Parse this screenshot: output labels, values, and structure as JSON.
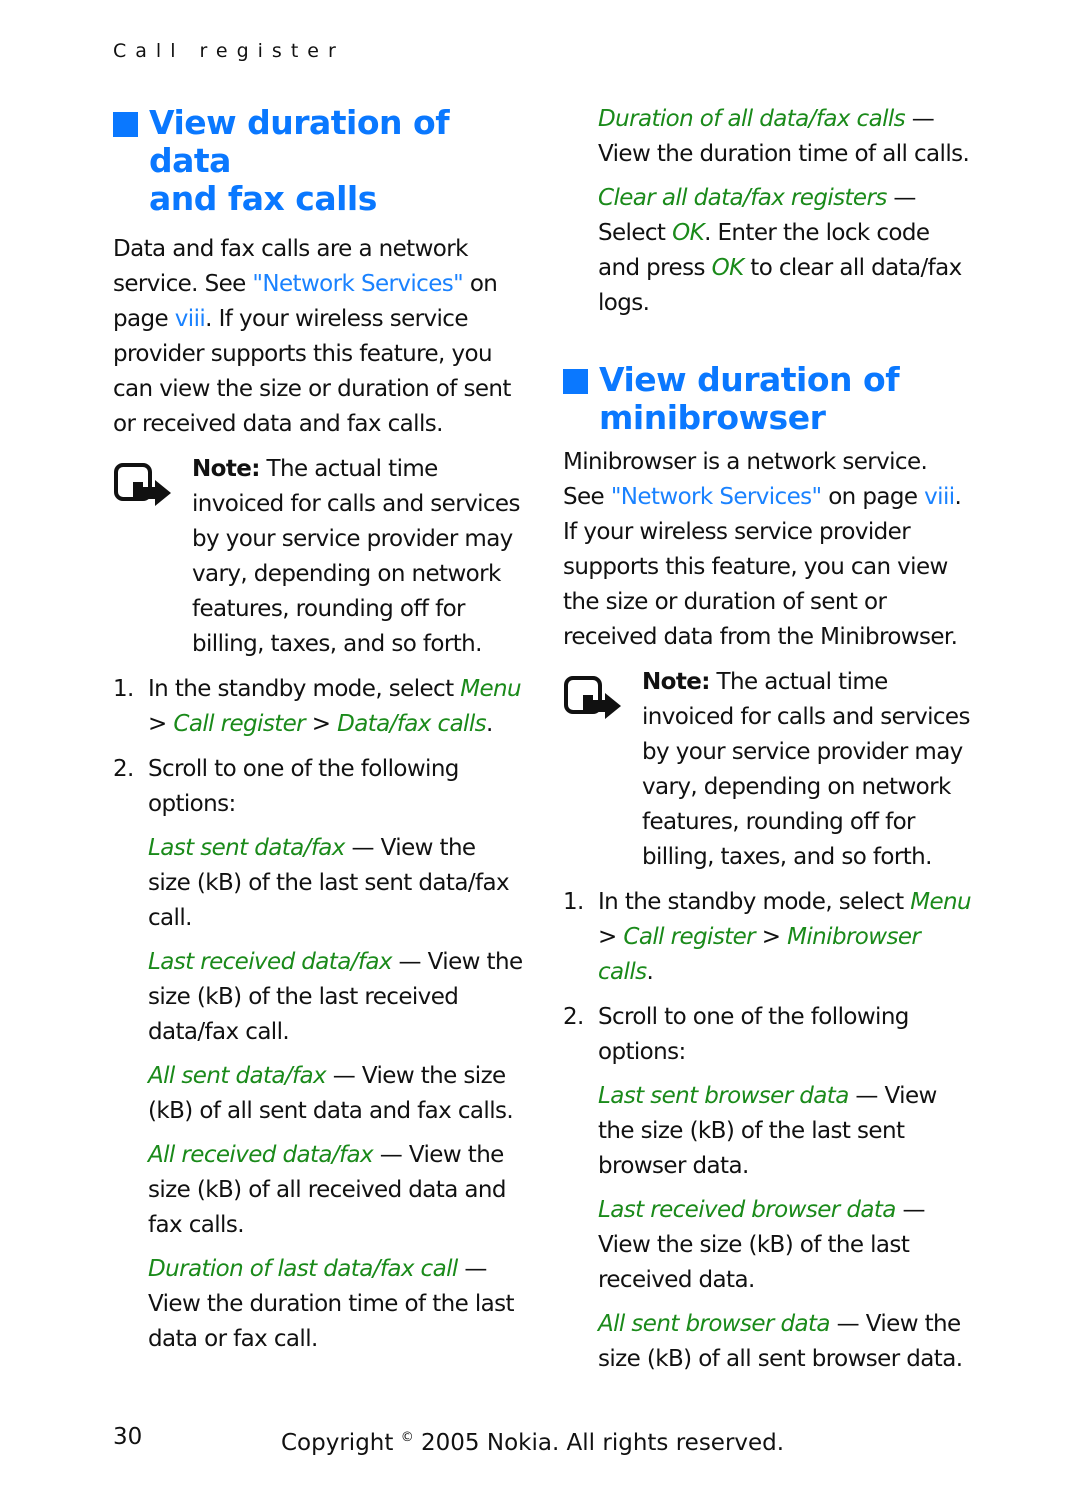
{
  "running_head": "Call register",
  "colors": {
    "heading_blue": "#0a78ff",
    "link_blue": "#1a82ff",
    "menu_green": "#1a8a1a",
    "text": "#111111"
  },
  "left": {
    "heading_line1": "View duration of data",
    "heading_line2": "and fax calls",
    "intro": {
      "pre": "Data and fax calls are a network service. See ",
      "link": "\"Network Services\"",
      "mid": " on page ",
      "page_link": "viii",
      "post": ". If your wireless service provider supports this feature, you can view the size or duration of sent or received data and fax calls."
    },
    "note": {
      "icon": "note-icon",
      "label": "Note:",
      "text": " The actual time invoiced for calls and services by your service provider may vary, depending on network features, rounding off for billing, taxes, and so forth."
    },
    "steps": [
      {
        "num": "1.",
        "text": "In the standby mode, select ",
        "path": [
          "Menu",
          "Call register",
          "Data/fax calls"
        ],
        "sep": " > ",
        "end": "."
      },
      {
        "num": "2.",
        "text": "Scroll to one of the following options:"
      }
    ],
    "options": [
      {
        "name": "Last sent data/fax",
        "desc": " — View the size (kB) of the last sent data/fax call."
      },
      {
        "name": "Last received data/fax",
        "desc": " — View the size (kB) of the last received data/fax call."
      },
      {
        "name": "All sent data/fax",
        "desc": " — View the size (kB) of all sent data and fax calls."
      },
      {
        "name": "All received data/fax",
        "desc": " — View the size (kB) of all received data and fax calls."
      },
      {
        "name": "Duration of last data/fax call",
        "desc": " — View the duration time of the last data or fax call."
      }
    ]
  },
  "right": {
    "options_cont": [
      {
        "name": "Duration of all data/fax calls",
        "desc": " — View the duration time of all calls."
      }
    ],
    "clear": {
      "name": "Clear all data/fax registers",
      "desc1": " — Select ",
      "ok1": "OK",
      "desc2": ". Enter the lock code and press ",
      "ok2": "OK",
      "desc3": " to clear all data/fax logs."
    },
    "heading_line1": "View duration of",
    "heading_line2": "minibrowser",
    "intro": {
      "pre": "Minibrowser is a network service. See ",
      "link": "\"Network Services\"",
      "mid": " on page ",
      "page_link": "viii",
      "post": ". If your wireless service provider supports this feature, you can view the size or duration of sent or received data from the Minibrowser."
    },
    "note": {
      "icon": "note-icon",
      "label": "Note:",
      "text": " The actual time invoiced for calls and services by your service provider may vary, depending on network features, rounding off for billing, taxes, and so forth."
    },
    "steps": [
      {
        "num": "1.",
        "text": "In the standby mode, select ",
        "path": [
          "Menu",
          "Call register",
          "Minibrowser calls"
        ],
        "sep": " > ",
        "end": "."
      },
      {
        "num": "2.",
        "text": "Scroll to one of the following options:"
      }
    ],
    "options": [
      {
        "name": "Last sent browser data",
        "desc": " — View the size (kB) of the last sent browser data."
      },
      {
        "name": "Last received browser data",
        "desc": " — View the size (kB) of the last received data."
      },
      {
        "name": "All sent browser data",
        "desc": " — View the size (kB) of all sent browser data."
      }
    ]
  },
  "footer": {
    "page_number": "30",
    "copyright_pre": "Copyright ",
    "copyright_symbol": "©",
    "copyright_post": " 2005 Nokia. All rights reserved."
  }
}
